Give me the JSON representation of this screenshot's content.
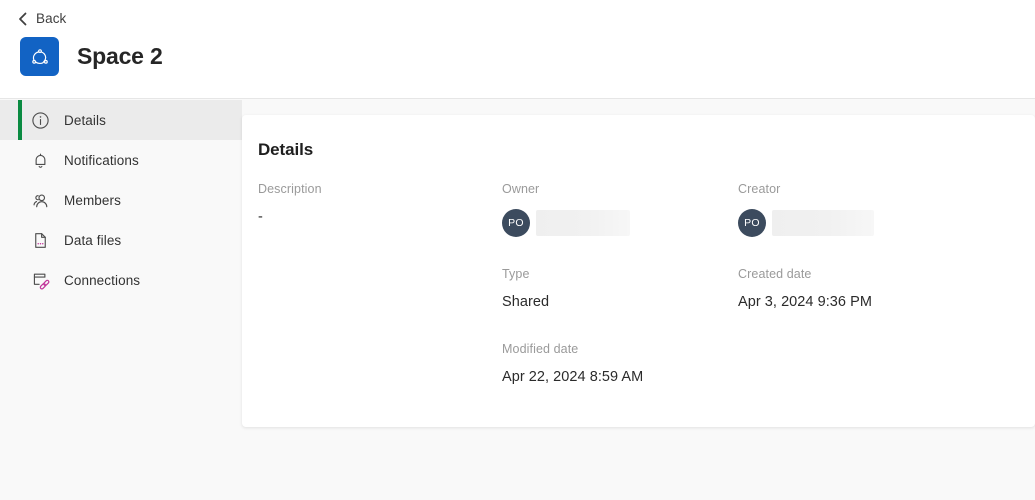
{
  "header": {
    "back_label": "Back",
    "back_icon": "chevron-left-icon",
    "app_icon": "space-ring-icon",
    "app_icon_color": "#1263c4",
    "title": "Space 2"
  },
  "sidebar": {
    "active_accent_color": "#098a41",
    "active_background": "#ebebeb",
    "items": [
      {
        "label": "Details",
        "icon": "info-circle-icon",
        "active": true
      },
      {
        "label": "Notifications",
        "icon": "bell-icon",
        "active": false
      },
      {
        "label": "Members",
        "icon": "people-icon",
        "active": false
      },
      {
        "label": "Data files",
        "icon": "file-data-icon",
        "active": false
      },
      {
        "label": "Connections",
        "icon": "connections-icon",
        "active": false
      }
    ]
  },
  "main": {
    "section_title": "Details",
    "fields": {
      "description": {
        "label": "Description",
        "value": "-"
      },
      "owner": {
        "label": "Owner",
        "avatar_initials": "PO",
        "avatar_color": "#3c4b5e",
        "value_redacted": true
      },
      "creator": {
        "label": "Creator",
        "avatar_initials": "PO",
        "avatar_color": "#3c4b5e",
        "value_redacted": true
      },
      "type": {
        "label": "Type",
        "value": "Shared"
      },
      "created_date": {
        "label": "Created date",
        "value": "Apr 3, 2024 9:36 PM"
      },
      "modified_date": {
        "label": "Modified date",
        "value": "Apr 22, 2024 8:59 AM"
      }
    }
  }
}
